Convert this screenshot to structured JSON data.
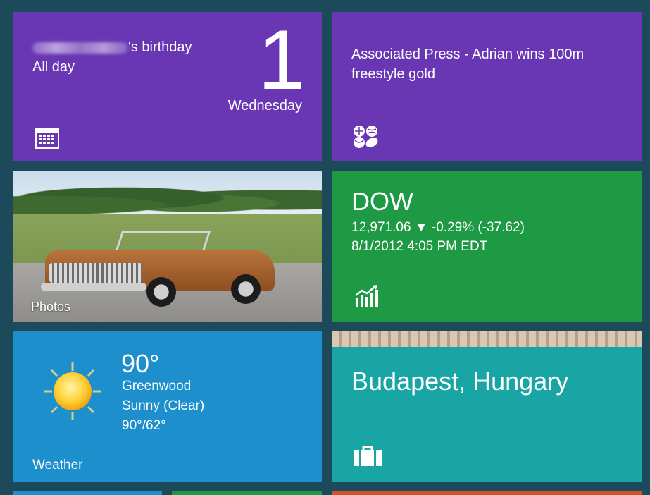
{
  "tiles": {
    "calendar": {
      "event_suffix": "'s birthday",
      "event_time": "All day",
      "day_number": "1",
      "weekday": "Wednesday",
      "icon": "calendar-icon",
      "color": "#6a37b4"
    },
    "news": {
      "headline_line1": "Associated Press - Adrian wins 100m",
      "headline_line2": "freestyle gold",
      "icon": "sports-icon",
      "color": "#6a37b4"
    },
    "photos": {
      "label": "Photos"
    },
    "finance": {
      "index": "DOW",
      "value_line": "12,971.06 ▼ -0.29% (-37.62)",
      "timestamp": "8/1/2012 4:05 PM EDT",
      "icon": "chart-icon",
      "color": "#1e9a45"
    },
    "weather": {
      "temperature": "90°",
      "location": "Greenwood",
      "condition": "Sunny (Clear)",
      "high_low": "90°/62°",
      "label": "Weather",
      "icon": "sun-icon",
      "color": "#1d8fcc"
    },
    "travel": {
      "destination": "Budapest, Hungary",
      "icon": "suitcase-icon",
      "color": "#1aa5a5"
    }
  }
}
